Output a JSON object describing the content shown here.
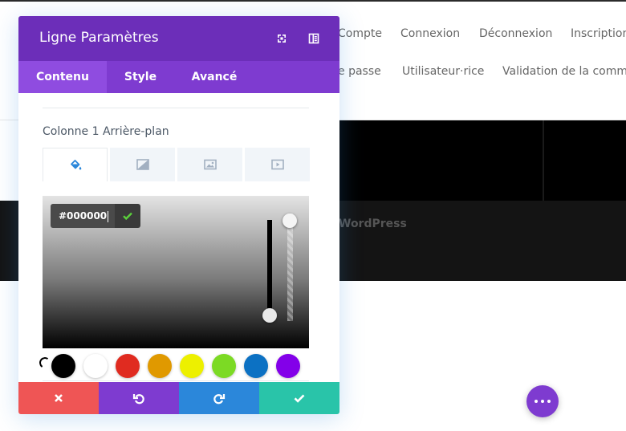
{
  "background_page": {
    "nav_row1": [
      "Compte",
      "Connexion",
      "Déconnexion",
      "Inscription"
    ],
    "nav_row2": [
      "e passe",
      "Utilisateur·rice",
      "Validation de la comma"
    ],
    "dark_section_text": "WordPress"
  },
  "modal": {
    "title": "Ligne Paramètres",
    "header_icons": [
      "fullscreen-icon",
      "sidebar-toggle-icon"
    ],
    "tabs": [
      {
        "label": "Contenu",
        "active": true
      },
      {
        "label": "Style",
        "active": false
      },
      {
        "label": "Avancé",
        "active": false
      }
    ],
    "section_label": "Colonne 1 Arrière-plan",
    "background_types": [
      "paint-bucket-icon",
      "gradient-icon",
      "image-icon",
      "video-icon"
    ],
    "color_picker": {
      "hex_value": "#000000",
      "selected_color": "#000000"
    },
    "swatches": [
      "#000000",
      "#ffffff",
      "#e02b20",
      "#e09900",
      "#edf000",
      "#7cda24",
      "#0c71c3",
      "#8300e9"
    ],
    "footer_buttons": [
      {
        "name": "cancel-button",
        "icon": "close-icon",
        "color": "#ef5555"
      },
      {
        "name": "undo-button",
        "icon": "undo-icon",
        "color": "#7e3bd0"
      },
      {
        "name": "redo-button",
        "icon": "redo-icon",
        "color": "#2b87da"
      },
      {
        "name": "save-button",
        "icon": "check-icon",
        "color": "#29c4a9"
      }
    ]
  },
  "colors": {
    "header_purple": "#6c2eb9",
    "tabs_purple": "#7e3bd0",
    "fab_purple": "#7e3bd0"
  }
}
